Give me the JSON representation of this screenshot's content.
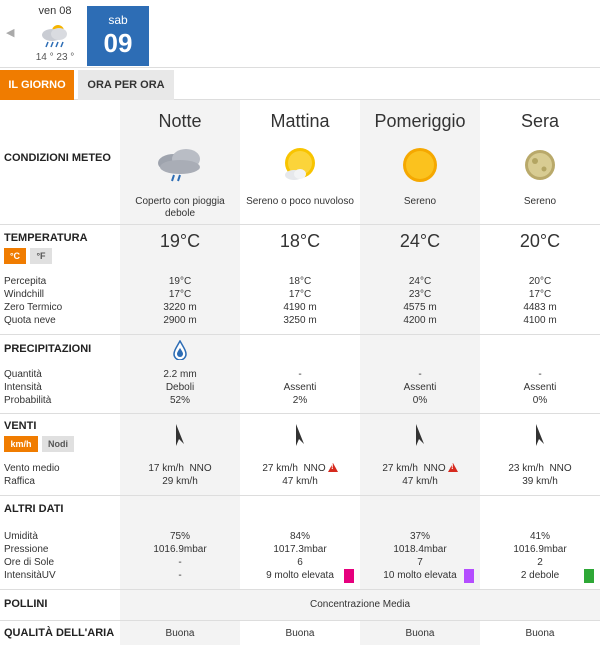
{
  "datebar": {
    "prev_day": {
      "label": "ven 08",
      "temps": "14 ° 23 °",
      "icon": "rain-cloud-icon"
    },
    "current_day": {
      "label": "sab",
      "number": "09"
    }
  },
  "tabs": {
    "day": "IL GIORNO",
    "hourly": "ORA PER ORA"
  },
  "periods": [
    {
      "name": "Notte",
      "icon": "cloud-rain-icon",
      "desc": "Coperto con pioggia debole",
      "temp": "19°C",
      "perceived": "19°C",
      "windchill": "17°C",
      "zero": "3220 m",
      "snow": "2900 m",
      "qty": "2.2 mm",
      "intensity": "Deboli",
      "prob": "52%",
      "wind": "17 km/h  NNO",
      "gust": "29 km/h",
      "warn": false,
      "humidity": "75%",
      "pressure": "1016.9mbar",
      "sun_hours": "-",
      "uv": "-",
      "uv_color": ""
    },
    {
      "name": "Mattina",
      "icon": "sun-cloud-icon",
      "desc": "Sereno o poco nuvoloso",
      "temp": "18°C",
      "perceived": "18°C",
      "windchill": "17°C",
      "zero": "4190 m",
      "snow": "3250 m",
      "qty": "-",
      "intensity": "Assenti",
      "prob": "2%",
      "wind": "27 km/h  NNO",
      "gust": "47 km/h",
      "warn": true,
      "humidity": "84%",
      "pressure": "1017.3mbar",
      "sun_hours": "6",
      "uv": "9 molto elevata",
      "uv_color": "#e6007e"
    },
    {
      "name": "Pomeriggio",
      "icon": "sun-icon",
      "desc": "Sereno",
      "temp": "24°C",
      "perceived": "24°C",
      "windchill": "23°C",
      "zero": "4575 m",
      "snow": "4200 m",
      "qty": "-",
      "intensity": "Assenti",
      "prob": "0%",
      "wind": "27 km/h  NNO",
      "gust": "47 km/h",
      "warn": true,
      "humidity": "37%",
      "pressure": "1018.4mbar",
      "sun_hours": "7",
      "uv": "10 molto elevata",
      "uv_color": "#b44dff"
    },
    {
      "name": "Sera",
      "icon": "moon-icon",
      "desc": "Sereno",
      "temp": "20°C",
      "perceived": "20°C",
      "windchill": "17°C",
      "zero": "4483 m",
      "snow": "4100 m",
      "qty": "-",
      "intensity": "Assenti",
      "prob": "0%",
      "wind": "23 km/h  NNO",
      "gust": "39 km/h",
      "warn": false,
      "humidity": "41%",
      "pressure": "1016.9mbar",
      "sun_hours": "2",
      "uv": "2 debole",
      "uv_color": "#2ea836"
    }
  ],
  "labels": {
    "conditions": "CONDIZIONI METEO",
    "temperature": "TEMPERATURA",
    "unit_c": "°C",
    "unit_f": "°F",
    "perceived": "Percepita",
    "windchill": "Windchill",
    "zero": "Zero Termico",
    "snow": "Quota neve",
    "precip": "PRECIPITAZIONI",
    "qty": "Quantità",
    "intensity": "Intensità",
    "prob": "Probabilità",
    "winds": "VENTI",
    "unit_kmh": "km/h",
    "unit_knots": "Nodi",
    "wind_avg": "Vento medio",
    "gust": "Raffica",
    "other": "ALTRI DATI",
    "humidity": "Umidità",
    "pressure": "Pressione",
    "sun_hours": "Ore di Sole",
    "uv": "IntensitàUV",
    "pollen": "POLLINI",
    "pollen_value": "Concentrazione Media",
    "air": "QUALITÀ DELL'ARIA"
  },
  "air_quality": [
    "Buona",
    "Buona",
    "Buona",
    "Buona"
  ]
}
